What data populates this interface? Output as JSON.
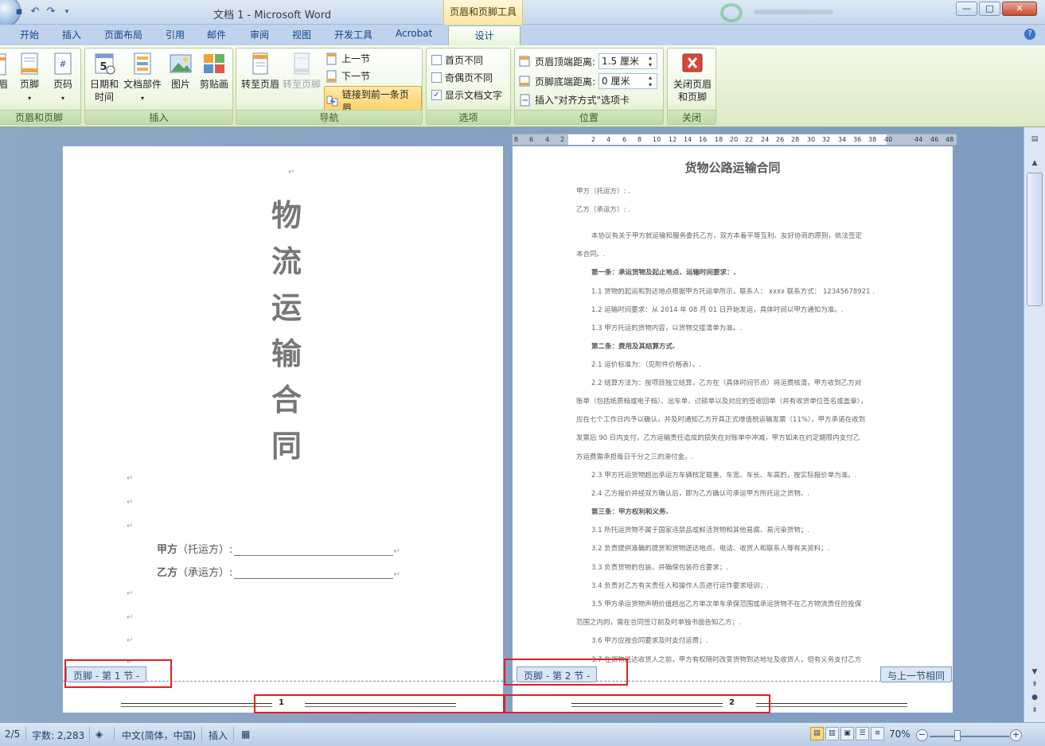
{
  "window": {
    "title": "文档 1 - Microsoft Word",
    "contextual_tab": "页眉和页脚工具"
  },
  "tabs": [
    "开始",
    "插入",
    "页面布局",
    "引用",
    "邮件",
    "审阅",
    "视图",
    "开发工具",
    "Acrobat",
    "设计"
  ],
  "active_tab": "设计",
  "ribbon": {
    "groups": {
      "header_footer": {
        "label": "页眉和页脚",
        "partial": "眉",
        "footer": "页脚",
        "page_number": "页码"
      },
      "insert": {
        "label": "插入",
        "datetime": "日期和\n时间",
        "date_line1": "日期和",
        "date_line2": "时间",
        "parts": "文档部件",
        "picture": "图片",
        "clipart": "剪贴画"
      },
      "navigation": {
        "label": "导航",
        "goto_header": "转至页眉",
        "goto_footer": "转至页脚",
        "prev": "上一节",
        "next": "下一节",
        "link_prev": "链接到前一条页眉"
      },
      "options": {
        "label": "选项",
        "first_page": "首页不同",
        "odd_even": "奇偶页不同",
        "show_text": "显示文档文字",
        "show_text_checked": true
      },
      "position": {
        "label": "位置",
        "header_dist_label": "页眉顶端距离:",
        "header_dist": "1.5 厘米",
        "footer_dist_label": "页脚底端距离:",
        "footer_dist": "0 厘米",
        "insert_align": "插入\"对齐方式\"选项卡"
      },
      "close": {
        "label": "关闭",
        "close_line1": "关闭页眉",
        "close_line2": "和页脚"
      }
    }
  },
  "ruler": {
    "ticks": [
      "8",
      "6",
      "4",
      "2",
      "2",
      "4",
      "6",
      "8",
      "10",
      "12",
      "14",
      "16",
      "18",
      "20",
      "22",
      "24",
      "26",
      "28",
      "30",
      "32",
      "34",
      "36",
      "38",
      "40",
      "44",
      "46",
      "48"
    ]
  },
  "page1": {
    "title_chars": [
      "物",
      "流",
      "运",
      "输",
      "合",
      "同"
    ],
    "party_a": "甲方",
    "party_a_role": "（托运方）:",
    "party_b": "乙方",
    "party_b_role": "（承运方）:",
    "footer_tab": "页脚 - 第 1 节 -",
    "page_number": "1"
  },
  "page2": {
    "heading": "货物公路运输合同",
    "lines": [
      "甲方（托运方）: .",
      "乙方（承运方）: .",
      "本协议有关于甲方就运输和服务委托乙方，双方本着平等互利、友好协商的原则，依法签定",
      "本合同。.",
      "第一条：承运货物及起止地点、运输时间要求：.",
      "1.1 货物的起运和到达地点根据甲方托运单所示，联系人： xxxx 联系方式： 12345678921 .",
      "1.2 运输时间要求：从 2014 年 08 月 01 日开始发运，具体时间以甲方通知为准。.",
      "1.3 甲方托运的货物内容，以货物交接清单为准。.",
      "第二条：费用及其结算方式.",
      "2.1 运价标准为：（见附件价格表）。.",
      "2.2 结算方法为：按项目独立结算，乙方在（具体时间节点）将运费核清，甲方收到乙方对",
      "账单（包括纸质档或电子档）、出车单、过磅单以及对应的签收回单（并有收货单位签名或盖章），",
      "应在七个工作日内予以确认，并及时通知乙方开具正式增值税运输发票（11%），甲方承诺在收到",
      "发票后 90 日内支付，乙方运输责任造成的损失在对账单中冲减，甲方如未在约定期限内支付乙",
      "方运费需承担每日千分之三的滞付金。.",
      "2.3 甲方托运货物超出承运方车辆核定载重、车宽、车长、车高的，按实际报价单为准。.",
      "2.4 乙方报价并经双方确认后，即为乙方确认可承运甲方所托运之货物。.",
      "第三条：甲方权利和义务.",
      "3.1 所托运货物不属于国家违禁品或鲜活货物和其他易腐、易污染货物；.",
      "3.2 负责提供准确的提货和货物送达地点、电话、收货人和联系人等有关资料；.",
      "3.3 负责货物的包装、并确保包装符合要求；.",
      "3.4 负责对乙方有关责任人和操作人员进行运作要求培训；.",
      "3.5 甲方承运货物声明价值超出乙方单次单车承保范围或承运货物不在乙方物流责任险投保",
      "范围之内的，需在合同签订前及时单独书面告知乙方；.",
      "3.6 甲方应按合同要求及时支付运费；.",
      "3.7 在货物送达收货人之前，甲方有权随时改变货物到达地址及收货人，但有义务支付乙方"
    ],
    "footer_tab": "页脚 - 第 2 节 -",
    "same_as_prev": "与上一节相同",
    "page_number": "2"
  },
  "statusbar": {
    "page": "2/5",
    "words": "字数: 2,283",
    "lang": "中文(简体，中国)",
    "mode": "插入",
    "zoom": "70%",
    "zoom_level": 0.35
  },
  "colors": {
    "highlight": "#e02020",
    "active_tab": "#e3f4d8"
  }
}
